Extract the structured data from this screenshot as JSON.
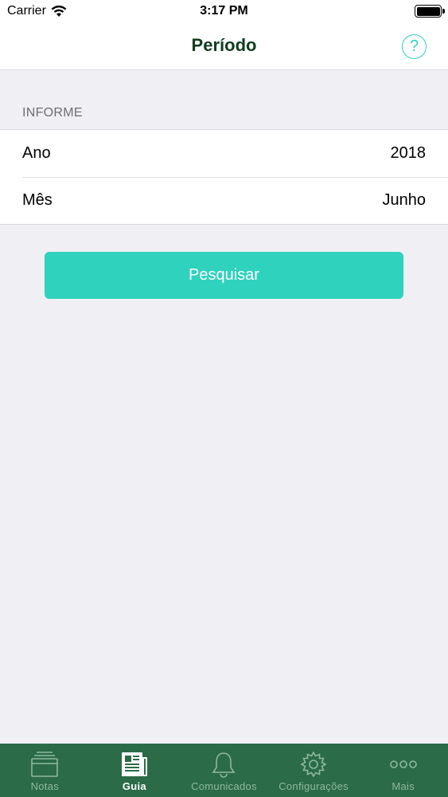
{
  "status_bar": {
    "carrier": "Carrier",
    "time": "3:17 PM"
  },
  "nav": {
    "title": "Período",
    "help_label": "?"
  },
  "section": {
    "header": "INFORME",
    "rows": [
      {
        "label": "Ano",
        "value": "2018"
      },
      {
        "label": "Mês",
        "value": "Junho"
      }
    ]
  },
  "search_button": {
    "label": "Pesquisar"
  },
  "tabs": [
    {
      "label": "Notas",
      "icon": "tray-icon",
      "active": false
    },
    {
      "label": "Guia",
      "icon": "newspaper-icon",
      "active": true
    },
    {
      "label": "Comunicados",
      "icon": "bell-icon",
      "active": false
    },
    {
      "label": "Configurações",
      "icon": "gear-icon",
      "active": false
    },
    {
      "label": "Mais",
      "icon": "more-icon",
      "active": false
    }
  ],
  "colors": {
    "accent": "#2fd2bd",
    "tab_bar": "#2b6b47",
    "title": "#0f3d1f"
  }
}
